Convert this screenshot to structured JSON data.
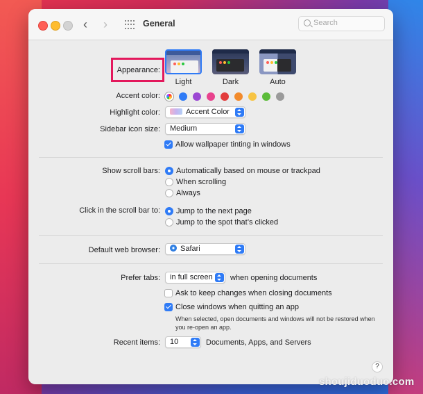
{
  "window": {
    "title": "General",
    "search_placeholder": "Search"
  },
  "appearance": {
    "label": "Appearance:",
    "options": [
      {
        "name": "Light",
        "selected": true
      },
      {
        "name": "Dark",
        "selected": false
      },
      {
        "name": "Auto",
        "selected": false
      }
    ]
  },
  "accent": {
    "label": "Accent color:",
    "colors": [
      "multicolor",
      "#2f7bf6",
      "#9b47d3",
      "#e8428d",
      "#e23c3c",
      "#f28a2b",
      "#f7c443",
      "#5cbc3a",
      "#9a9a9a"
    ]
  },
  "highlight": {
    "label": "Highlight color:",
    "value": "Accent Color"
  },
  "sidebar_icon": {
    "label": "Sidebar icon size:",
    "value": "Medium"
  },
  "wallpaper_tinting": {
    "label": "Allow wallpaper tinting in windows",
    "checked": true
  },
  "scroll_bars": {
    "label": "Show scroll bars:",
    "options": [
      {
        "name": "Automatically based on mouse or trackpad",
        "selected": true
      },
      {
        "name": "When scrolling",
        "selected": false
      },
      {
        "name": "Always",
        "selected": false
      }
    ]
  },
  "scroll_click": {
    "label": "Click in the scroll bar to:",
    "options": [
      {
        "name": "Jump to the next page",
        "selected": true
      },
      {
        "name": "Jump to the spot that’s clicked",
        "selected": false
      }
    ]
  },
  "browser": {
    "label": "Default web browser:",
    "value": "Safari"
  },
  "tabs": {
    "label": "Prefer tabs:",
    "value": "in full screen",
    "suffix": "when opening documents"
  },
  "ask_keep": {
    "label": "Ask to keep changes when closing documents",
    "checked": false
  },
  "close_windows": {
    "label": "Close windows when quitting an app",
    "checked": true,
    "note": "When selected, open documents and windows will not be restored when you re-open an app."
  },
  "recent": {
    "label": "Recent items:",
    "value": "10",
    "suffix": "Documents, Apps, and Servers"
  },
  "help_label": "?",
  "watermark": "shoujiduoduo.com"
}
